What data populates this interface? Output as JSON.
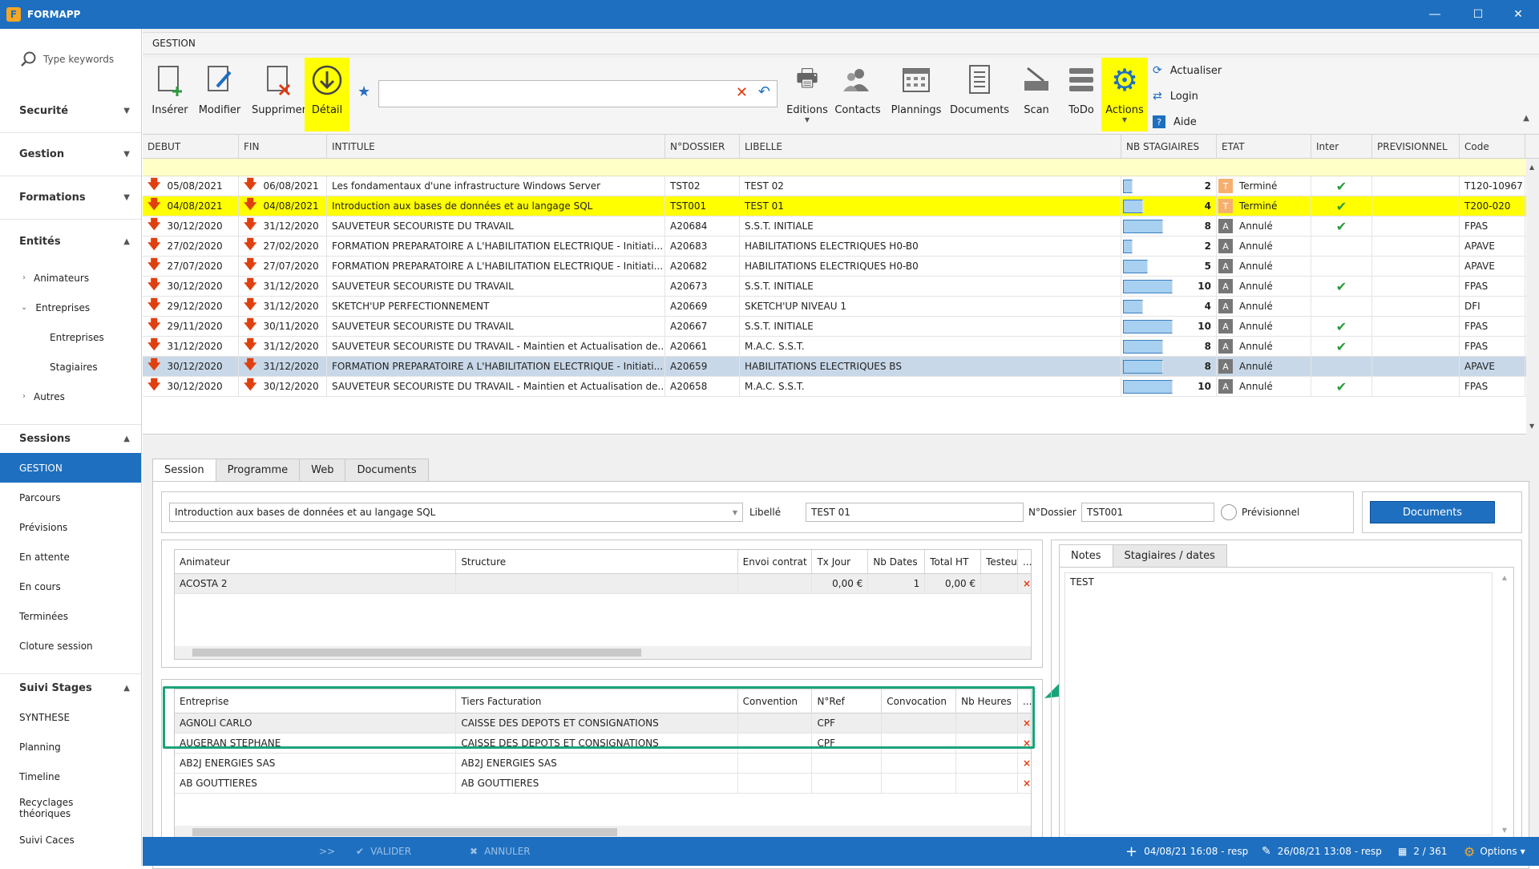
{
  "window": {
    "title": "FORMAPP",
    "logo": "F"
  },
  "sidebar": {
    "search_placeholder": "Type keywords",
    "sections": [
      {
        "label": "Securité"
      },
      {
        "label": "Gestion"
      },
      {
        "label": "Formations"
      },
      {
        "label": "Entités"
      }
    ],
    "entites_items": [
      {
        "label": "Animateurs"
      },
      {
        "label": "Entreprises"
      },
      {
        "label": "Entreprises"
      },
      {
        "label": "Stagiaires"
      },
      {
        "label": "Autres"
      }
    ],
    "sessions_label": "Sessions",
    "sessions_items": [
      {
        "label": "GESTION"
      },
      {
        "label": "Parcours"
      },
      {
        "label": "Prévisions"
      },
      {
        "label": "En attente"
      },
      {
        "label": "En cours"
      },
      {
        "label": "Terminées"
      },
      {
        "label": "Cloture session"
      }
    ],
    "suivi_label": "Suivi Stages",
    "suivi_items": [
      {
        "label": "SYNTHESE"
      },
      {
        "label": "Planning"
      },
      {
        "label": "Timeline"
      },
      {
        "label": "Recyclages théoriques"
      },
      {
        "label": "Suivi Caces"
      }
    ]
  },
  "header": {
    "title": "GESTION"
  },
  "toolbar": {
    "inserer": "Insérer",
    "modifier": "Modifier",
    "supprimer": "Supprimer",
    "detail": "Détail",
    "editions": "Editions",
    "contacts": "Contacts",
    "plannings": "Plannings",
    "documents": "Documents",
    "scan": "Scan",
    "todo": "ToDo",
    "actions": "Actions",
    "actualiser": "Actualiser",
    "login": "Login",
    "aide": "Aide",
    "filter_value": ""
  },
  "grid": {
    "columns": [
      "DEBUT",
      "FIN",
      "INTITULE",
      "N°DOSSIER",
      "LIBELLE",
      "NB STAGIAIRES",
      "ETAT",
      "Inter",
      "PREVISIONNEL",
      "Code"
    ],
    "rows": [
      {
        "debut": "05/08/2021",
        "fin": "06/08/2021",
        "intitule": "Les fondamentaux d'une infrastructure Windows Server",
        "dossier": "TST02",
        "libelle": "TEST 02",
        "nb": "2",
        "nbfrac": 0.2,
        "etat_code": "T",
        "etat": "Terminé",
        "inter": "✔",
        "prev": "",
        "code": "T120-10967",
        "state": ""
      },
      {
        "debut": "04/08/2021",
        "fin": "04/08/2021",
        "intitule": "Introduction aux bases de données et au langage SQL",
        "dossier": "TST001",
        "libelle": "TEST 01",
        "nb": "4",
        "nbfrac": 0.4,
        "etat_code": "T",
        "etat": "Terminé",
        "inter": "✔",
        "prev": "",
        "code": "T200-020",
        "state": "sel"
      },
      {
        "debut": "30/12/2020",
        "fin": "31/12/2020",
        "intitule": "SAUVETEUR SECOURISTE DU TRAVAIL",
        "dossier": "A20684",
        "libelle": "S.S.T. INITIALE",
        "nb": "8",
        "nbfrac": 0.8,
        "etat_code": "A",
        "etat": "Annulé",
        "inter": "✔",
        "prev": "",
        "code": "FPAS",
        "state": ""
      },
      {
        "debut": "27/02/2020",
        "fin": "27/02/2020",
        "intitule": "FORMATION PREPARATOIRE A L'HABILITATION ELECTRIQUE - Initiati...",
        "dossier": "A20683",
        "libelle": "HABILITATIONS ELECTRIQUES H0-B0",
        "nb": "2",
        "nbfrac": 0.2,
        "etat_code": "A",
        "etat": "Annulé",
        "inter": "",
        "prev": "",
        "code": "APAVE",
        "state": ""
      },
      {
        "debut": "27/07/2020",
        "fin": "27/07/2020",
        "intitule": "FORMATION PREPARATOIRE A L'HABILITATION ELECTRIQUE - Initiati...",
        "dossier": "A20682",
        "libelle": "HABILITATIONS ELECTRIQUES H0-B0",
        "nb": "5",
        "nbfrac": 0.5,
        "etat_code": "A",
        "etat": "Annulé",
        "inter": "",
        "prev": "",
        "code": "APAVE",
        "state": ""
      },
      {
        "debut": "30/12/2020",
        "fin": "31/12/2020",
        "intitule": "SAUVETEUR SECOURISTE DU TRAVAIL",
        "dossier": "A20673",
        "libelle": "S.S.T. INITIALE",
        "nb": "10",
        "nbfrac": 1.0,
        "etat_code": "A",
        "etat": "Annulé",
        "inter": "✔",
        "prev": "",
        "code": "FPAS",
        "state": ""
      },
      {
        "debut": "29/12/2020",
        "fin": "31/12/2020",
        "intitule": "SKETCH'UP PERFECTIONNEMENT",
        "dossier": "A20669",
        "libelle": "SKETCH'UP NIVEAU 1",
        "nb": "4",
        "nbfrac": 0.4,
        "etat_code": "A",
        "etat": "Annulé",
        "inter": "",
        "prev": "",
        "code": "DFI",
        "state": ""
      },
      {
        "debut": "29/11/2020",
        "fin": "30/11/2020",
        "intitule": "SAUVETEUR SECOURISTE DU TRAVAIL",
        "dossier": "A20667",
        "libelle": "S.S.T. INITIALE",
        "nb": "10",
        "nbfrac": 1.0,
        "etat_code": "A",
        "etat": "Annulé",
        "inter": "✔",
        "prev": "",
        "code": "FPAS",
        "state": ""
      },
      {
        "debut": "31/12/2020",
        "fin": "31/12/2020",
        "intitule": "SAUVETEUR SECOURISTE DU TRAVAIL - Maintien et Actualisation de...",
        "dossier": "A20661",
        "libelle": "M.A.C. S.S.T.",
        "nb": "8",
        "nbfrac": 0.8,
        "etat_code": "A",
        "etat": "Annulé",
        "inter": "✔",
        "prev": "",
        "code": "FPAS",
        "state": ""
      },
      {
        "debut": "30/12/2020",
        "fin": "31/12/2020",
        "intitule": "FORMATION PREPARATOIRE A L'HABILITATION ELECTRIQUE - Initiati...",
        "dossier": "A20659",
        "libelle": "HABILITATIONS ELECTRIQUES BS",
        "nb": "8",
        "nbfrac": 0.8,
        "etat_code": "A",
        "etat": "Annulé",
        "inter": "",
        "prev": "",
        "code": "APAVE",
        "state": "hl"
      },
      {
        "debut": "30/12/2020",
        "fin": "30/12/2020",
        "intitule": "SAUVETEUR SECOURISTE DU TRAVAIL - Maintien et Actualisation de...",
        "dossier": "A20658",
        "libelle": "M.A.C. S.S.T.",
        "nb": "10",
        "nbfrac": 1.0,
        "etat_code": "A",
        "etat": "Annulé",
        "inter": "✔",
        "prev": "",
        "code": "FPAS",
        "state": ""
      }
    ]
  },
  "detail": {
    "tabs": [
      "Session",
      "Programme",
      "Web",
      "Documents"
    ],
    "intitule": "Introduction aux bases de données et au langage SQL",
    "libelle_label": "Libellé",
    "libelle": "TEST 01",
    "dossier_label": "N°Dossier",
    "dossier": "TST001",
    "previsionnel_label": "Prévisionnel",
    "documents_btn": "Documents",
    "anim_columns": [
      "Animateur",
      "Structure",
      "Envoi contrat",
      "Tx Jour",
      "Nb Dates",
      "Total HT",
      "Testeu",
      "..."
    ],
    "anim_rows": [
      {
        "animateur": "ACOSTA 2",
        "structure": "",
        "envoi": "",
        "tx": "0,00 €",
        "nbdates": "1",
        "total": "0,00 €",
        "testeu": "",
        "del": "×"
      }
    ],
    "ent_columns": [
      "Entreprise",
      "Tiers Facturation",
      "Convention",
      "N°Ref",
      "Convocation",
      "Nb Heures",
      "..."
    ],
    "ent_rows": [
      {
        "entreprise": "AGNOLI CARLO",
        "tiers": "CAISSE DES DEPOTS ET CONSIGNATIONS",
        "convention": "",
        "ref": "CPF",
        "convocation": "",
        "heures": "",
        "del": "×"
      },
      {
        "entreprise": "AUGERAN STEPHANE",
        "tiers": "CAISSE DES DEPOTS ET CONSIGNATIONS",
        "convention": "",
        "ref": "CPF",
        "convocation": "",
        "heures": "",
        "del": "×"
      },
      {
        "entreprise": "AB2J ENERGIES SAS",
        "tiers": "AB2J ENERGIES SAS",
        "convention": "",
        "ref": "",
        "convocation": "",
        "heures": "",
        "del": "×"
      },
      {
        "entreprise": "AB GOUTTIERES",
        "tiers": "AB GOUTTIERES",
        "convention": "",
        "ref": "",
        "convocation": "",
        "heures": "",
        "del": "×"
      }
    ],
    "notes_tabs": [
      "Notes",
      "Stagiaires / dates"
    ],
    "notes_text": "TEST"
  },
  "statusbar": {
    "expand": ">>",
    "valider": "VALIDER",
    "annuler": "ANNULER",
    "created": "04/08/21 16:08 - resp",
    "modified": "26/08/21 13:08 - resp",
    "count": "2 / 361",
    "options": "Options"
  },
  "colors": {
    "accent": "#1e6fbf",
    "selected_row": "#ffff00",
    "annotation": "#1aa37a"
  }
}
